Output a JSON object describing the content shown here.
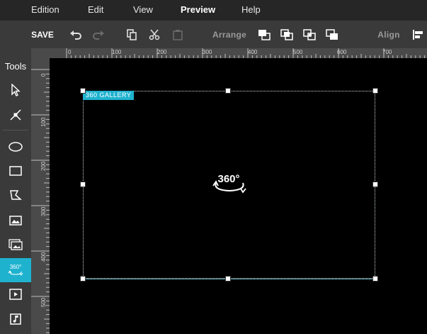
{
  "menu": {
    "items": [
      {
        "label": "Edition",
        "active": false
      },
      {
        "label": "Edit",
        "active": false
      },
      {
        "label": "View",
        "active": false
      },
      {
        "label": "Preview",
        "active": true
      },
      {
        "label": "Help",
        "active": false
      }
    ]
  },
  "toolbar": {
    "save_label": "SAVE",
    "arrange_label": "Arrange",
    "align_label": "Align"
  },
  "ruler": {
    "h_ticks": [
      "0",
      "100",
      "200",
      "300",
      "400",
      "500",
      "600",
      "700"
    ],
    "v_ticks": [
      "0",
      "100",
      "200",
      "300",
      "400",
      "500"
    ]
  },
  "tools": {
    "title": "Tools",
    "active_tool": "360-gallery",
    "items": [
      {
        "name": "select-tool",
        "icon": "pointer-icon"
      },
      {
        "name": "node-tool",
        "icon": "node-edit-icon"
      },
      {
        "name": "ellipse-tool",
        "icon": "ellipse-icon"
      },
      {
        "name": "rectangle-tool",
        "icon": "rectangle-icon"
      },
      {
        "name": "polygon-tool",
        "icon": "polygon-icon"
      },
      {
        "name": "image-tool",
        "icon": "image-icon"
      },
      {
        "name": "gallery-tool",
        "icon": "gallery-icon"
      },
      {
        "name": "360-gallery-tool",
        "icon": "360-icon",
        "label": "360°"
      },
      {
        "name": "video-tool",
        "icon": "video-icon"
      },
      {
        "name": "audio-tool",
        "icon": "audio-icon"
      }
    ]
  },
  "canvas": {
    "widget_label": "360 GALLERY",
    "widget_icon_text": "360°",
    "accent_color": "#1fb2cf"
  }
}
